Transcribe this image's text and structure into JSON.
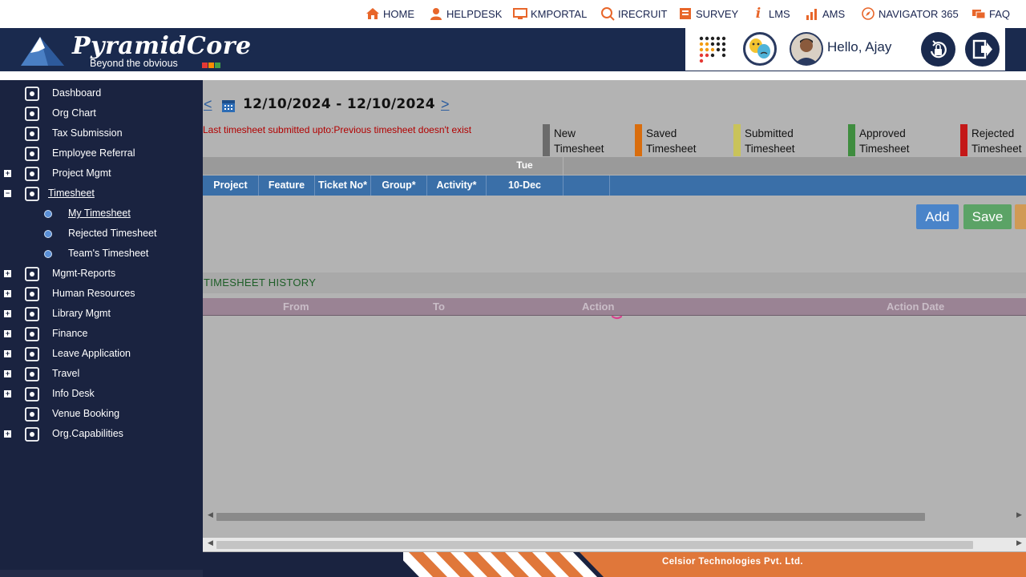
{
  "top_nav": [
    {
      "label": "HOME",
      "icon": "home-icon"
    },
    {
      "label": "HELPDESK",
      "icon": "helpdesk-icon"
    },
    {
      "label": "KMPORTAL",
      "icon": "kmportal-icon"
    },
    {
      "label": "IRECRUIT",
      "icon": "irecruit-icon"
    },
    {
      "label": "SURVEY",
      "icon": "survey-icon"
    },
    {
      "label": "LMS",
      "icon": "info-i-icon"
    },
    {
      "label": "AMS",
      "icon": "bar-chart-icon"
    },
    {
      "label": "NAVIGATOR 365",
      "icon": "compass-icon"
    },
    {
      "label": "FAQ",
      "icon": "faq-icon"
    }
  ],
  "header": {
    "logo_text": "PyramidCore",
    "logo_tagline": "Beyond the obvious",
    "greeting": "Hello, Ajay",
    "colors": {
      "bg": "#1a2a4e",
      "accent_red": "#e53935",
      "accent_orange": "#fb8c00",
      "accent_green": "#43a047"
    }
  },
  "sidebar": {
    "items": [
      {
        "label": "Dashboard",
        "icon": "dashboard-icon",
        "expand": ""
      },
      {
        "label": "Org Chart",
        "icon": "org-chart-icon",
        "expand": ""
      },
      {
        "label": "Tax Submission",
        "icon": "tax-icon",
        "expand": ""
      },
      {
        "label": "Employee Referral",
        "icon": "referral-icon",
        "expand": ""
      },
      {
        "label": "Project Mgmt",
        "icon": "project-icon",
        "expand": "+"
      },
      {
        "label": "Timesheet",
        "icon": "timesheet-icon",
        "expand": "−"
      },
      {
        "label": "Mgmt-Reports",
        "icon": "reports-icon",
        "expand": "+"
      },
      {
        "label": "Human Resources",
        "icon": "hr-icon",
        "expand": "+"
      },
      {
        "label": "Library Mgmt",
        "icon": "library-icon",
        "expand": "+"
      },
      {
        "label": "Finance",
        "icon": "finance-icon",
        "expand": "+"
      },
      {
        "label": "Leave Application",
        "icon": "leave-icon",
        "expand": "+"
      },
      {
        "label": "Travel",
        "icon": "travel-icon",
        "expand": "+"
      },
      {
        "label": "Info Desk",
        "icon": "info-icon",
        "expand": "+"
      },
      {
        "label": "Venue Booking",
        "icon": "calendar-icon",
        "expand": ""
      },
      {
        "label": "Org.Capabilities",
        "icon": "capabilities-icon",
        "expand": "+"
      }
    ],
    "timesheet_sub": [
      "My Timesheet",
      "Rejected Timesheet",
      "Team's Timesheet"
    ]
  },
  "main": {
    "prev": "<",
    "next": ">",
    "date_range": "12/10/2024 - 12/10/2024",
    "warning": "Last timesheet submitted upto:Previous timesheet doesn't exist",
    "legend": [
      {
        "line1": "New",
        "line2": "Timesheet",
        "color": "#6b6b6b"
      },
      {
        "line1": "Saved",
        "line2": "Timesheet",
        "color": "#d96d0d"
      },
      {
        "line1": "Submitted",
        "line2": "Timesheet",
        "color": "#c9c35a"
      },
      {
        "line1": "Approved",
        "line2": "Timesheet",
        "color": "#3f8d3f"
      },
      {
        "line1": "Rejected",
        "line2": "Timesheet",
        "color": "#c41818"
      }
    ],
    "day": "Tue",
    "columns": [
      "Project",
      "Feature",
      "Ticket No*",
      "Group*",
      "Activity*",
      "10-Dec"
    ],
    "buttons": {
      "add": "Add",
      "save": "Save"
    },
    "history_title": "TIMESHEET HISTORY",
    "history_columns": [
      "From",
      "To",
      "Action",
      "Action Date"
    ]
  },
  "footer": {
    "company": "Celsior Technologies Pvt. Ltd."
  }
}
